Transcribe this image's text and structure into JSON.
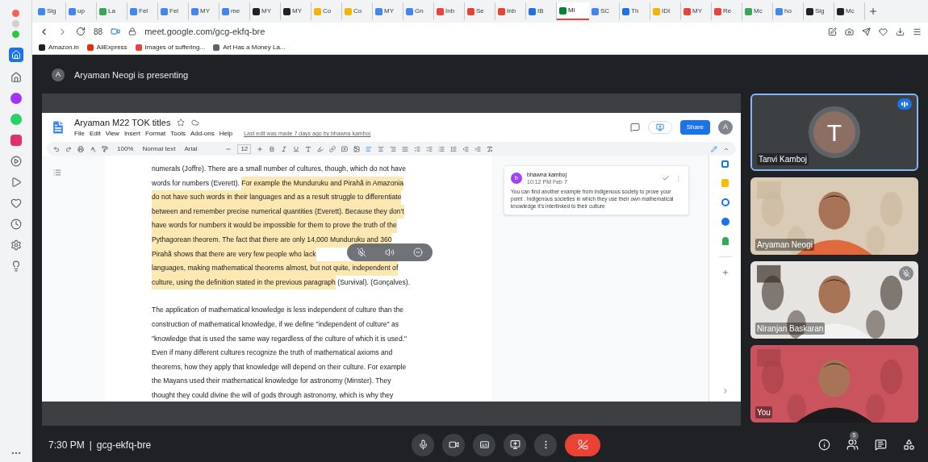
{
  "browser": {
    "tabs": [
      {
        "label": "Sig",
        "color": "#4285f4",
        "selected": false
      },
      {
        "label": "up",
        "color": "#4285f4",
        "selected": false
      },
      {
        "label": "La",
        "color": "#34a853",
        "selected": false
      },
      {
        "label": "Fel",
        "color": "#4285f4",
        "selected": false
      },
      {
        "label": "Fel",
        "color": "#4285f4",
        "selected": false
      },
      {
        "label": "MY",
        "color": "#4285f4",
        "selected": false
      },
      {
        "label": "me",
        "color": "#4285f4",
        "selected": false
      },
      {
        "label": "MY",
        "color": "#202124",
        "selected": false
      },
      {
        "label": "MY",
        "color": "#202124",
        "selected": false
      },
      {
        "label": "Co",
        "color": "#f4b400",
        "selected": false
      },
      {
        "label": "Co",
        "color": "#f4b400",
        "selected": false
      },
      {
        "label": "MY",
        "color": "#4285f4",
        "selected": false
      },
      {
        "label": "Gn",
        "color": "#4285f4",
        "selected": false
      },
      {
        "label": "Inb",
        "color": "#ea4335",
        "selected": false
      },
      {
        "label": "Se",
        "color": "#ea4335",
        "selected": false
      },
      {
        "label": "Inb",
        "color": "#ea4335",
        "selected": false
      },
      {
        "label": "IB",
        "color": "#1a73e8",
        "selected": false
      },
      {
        "label": "Mi",
        "color": "#00832d",
        "selected": true
      },
      {
        "label": "SC",
        "color": "#4285f4",
        "selected": false
      },
      {
        "label": "Th",
        "color": "#1a73e8",
        "selected": false
      },
      {
        "label": "IDI",
        "color": "#f4b400",
        "selected": false
      },
      {
        "label": "MY",
        "color": "#ea4335",
        "selected": false
      },
      {
        "label": "Re",
        "color": "#ea4335",
        "selected": false
      },
      {
        "label": "Mc",
        "color": "#34a853",
        "selected": false
      },
      {
        "label": "ho",
        "color": "#4285f4",
        "selected": false
      },
      {
        "label": "Sig",
        "color": "#202124",
        "selected": false
      },
      {
        "label": "Mc",
        "color": "#202124",
        "selected": false
      }
    ],
    "extensions_label": "88",
    "address": "meet.google.com/gcg-ekfq-bre",
    "bookmarks": [
      {
        "label": "Amazon.in",
        "color": "#202124"
      },
      {
        "label": "AliExpress",
        "color": "#e62e04"
      },
      {
        "label": "Images of suffering...",
        "color": "#ea4335"
      },
      {
        "label": "Art Has a Money La...",
        "color": "#5f6368"
      }
    ]
  },
  "meet": {
    "presenter": {
      "initial": "A",
      "text": "Aryaman Neogi is presenting"
    },
    "doc": {
      "title": "Aryaman M22 TOK titles",
      "menu": [
        "File",
        "Edit",
        "View",
        "Insert",
        "Format",
        "Tools",
        "Add-ons",
        "Help"
      ],
      "last_edit": "Last edit was made 7 days ago by bhawna kamboj",
      "share": "Share",
      "user_initial": "A",
      "toolbar": {
        "zoom": "100%",
        "style": "Normal text",
        "font": "Arial",
        "size": "12"
      },
      "paragraphs": [
        [
          [
            {
              "text": "numerals (Joffre). There are a small number of cultures, though, which do not have",
              "highlighted": false
            }
          ],
          [
            {
              "text": "words for numbers (Everett). ",
              "highlighted": false
            },
            {
              "text": "For example the Munduruku and Pirahã in Amazonia",
              "highlighted": true
            }
          ],
          [
            {
              "text": "do not have such words in their languages and as a result struggle to differentiate",
              "highlighted": true
            }
          ],
          [
            {
              "text": "between and remember precise numerical quantities (Everett). Because they don't",
              "highlighted": true
            }
          ],
          [
            {
              "text": "have words for numbers it would be impossible for them to prove the truth of the",
              "highlighted": true
            }
          ],
          [
            {
              "text": "Pythagorean theorem. The fact that there are only 14,000 Munduruku and 360",
              "highlighted": true
            }
          ],
          [
            {
              "text": "Pirahã shows that there are very few people who lack",
              "highlighted": true
            }
          ],
          [
            {
              "text": "languages, making mathematical theorems almost, but not quite, independent of",
              "highlighted": true
            }
          ],
          [
            {
              "text": "culture, using the definition stated in the previous paragraph",
              "highlighted": true
            },
            {
              "text": " (Survival). (Gonçalves).",
              "highlighted": false
            }
          ]
        ],
        [
          [
            {
              "text": "The application of mathematical knowledge is less independent of culture than the",
              "highlighted": false
            }
          ],
          [
            {
              "text": "construction of mathematical knowledge, if we define \"independent of culture\" as",
              "highlighted": false
            }
          ],
          [
            {
              "text": "\"knowledge that is used the same way regardless of the culture of which it is used.\"",
              "highlighted": false
            }
          ],
          [
            {
              "text": "Even if many different cultures recognize the truth of mathematical axioms and",
              "highlighted": false
            }
          ],
          [
            {
              "text": "theorems, how they apply that knowledge will depend on their culture. For example",
              "highlighted": false
            }
          ],
          [
            {
              "text": "the Mayans used their mathematical knowledge for astronomy (Minster). They",
              "highlighted": false
            }
          ],
          [
            {
              "text": "thought they could divine the will of gods through astronomy, which is why they",
              "highlighted": false
            }
          ]
        ]
      ],
      "comment": {
        "initial": "b",
        "author": "bhawna kamboj",
        "time": "10:12 PM Feb 7",
        "text": "You can find another example from indigenous society to prove your point . Indigenous societies in which they use their own mathematical knowledge it's interlinked to their culture"
      }
    },
    "tiles": [
      {
        "kind": "avatar",
        "name": "Tanvi Kamboj",
        "initial": "T",
        "speaking": true,
        "muted": false
      },
      {
        "kind": "video",
        "name": "Aryaman Neogi",
        "speaking": false,
        "muted": false
      },
      {
        "kind": "video",
        "name": "Niranjan Baskaran",
        "speaking": false,
        "muted": true
      },
      {
        "kind": "video",
        "name": "You",
        "speaking": false,
        "muted": false
      }
    ]
  },
  "bottom": {
    "time": "7:30 PM",
    "separator": "|",
    "code": "gcg-ekfq-bre",
    "people_count": "5"
  }
}
